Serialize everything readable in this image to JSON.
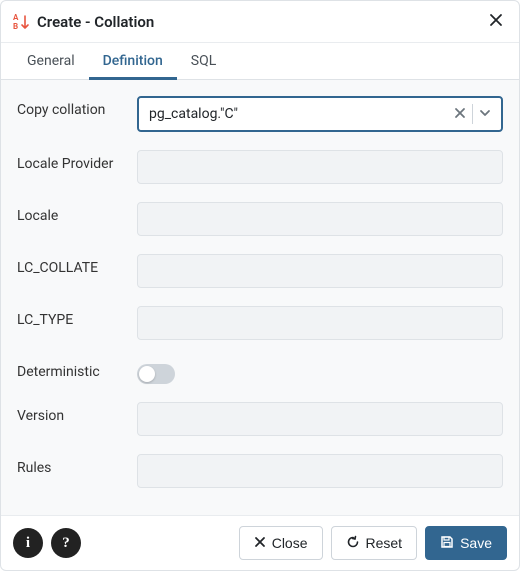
{
  "header": {
    "title": "Create - Collation"
  },
  "tabs": {
    "general": "General",
    "definition": "Definition",
    "sql": "SQL",
    "active": "definition"
  },
  "form": {
    "copy_collation": {
      "label": "Copy collation",
      "value": "pg_catalog.\"C\""
    },
    "locale_provider": {
      "label": "Locale Provider",
      "value": ""
    },
    "locale": {
      "label": "Locale",
      "value": ""
    },
    "lc_collate": {
      "label": "LC_COLLATE",
      "value": ""
    },
    "lc_type": {
      "label": "LC_TYPE",
      "value": ""
    },
    "deterministic": {
      "label": "Deterministic",
      "value": false
    },
    "version": {
      "label": "Version",
      "value": ""
    },
    "rules": {
      "label": "Rules",
      "value": ""
    }
  },
  "footer": {
    "close": "Close",
    "reset": "Reset",
    "save": "Save"
  }
}
